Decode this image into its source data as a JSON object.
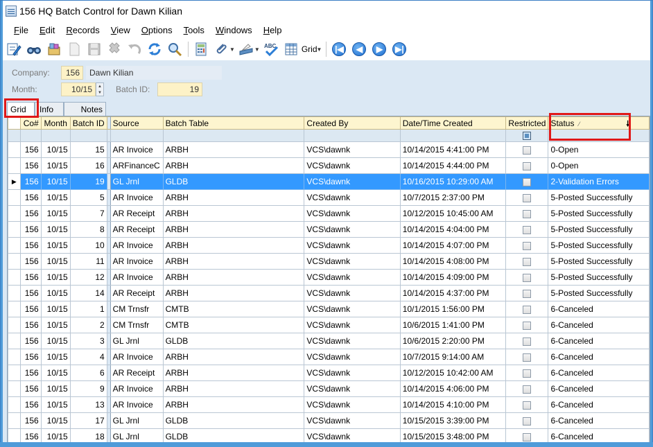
{
  "window": {
    "title": "156 HQ Batch Control for Dawn Kilian"
  },
  "menu": [
    {
      "label": "File",
      "underline": "F",
      "rest": "ile"
    },
    {
      "label": "Edit",
      "underline": "E",
      "rest": "dit"
    },
    {
      "label": "Records",
      "underline": "R",
      "rest": "ecords"
    },
    {
      "label": "View",
      "underline": "V",
      "rest": "iew"
    },
    {
      "label": "Options",
      "underline": "O",
      "rest": "ptions"
    },
    {
      "label": "Tools",
      "underline": "T",
      "rest": "ools"
    },
    {
      "label": "Windows",
      "underline": "W",
      "rest": "indows"
    },
    {
      "label": "Help",
      "underline": "H",
      "rest": "elp"
    }
  ],
  "toolbar": {
    "grid_label": "Grid"
  },
  "form": {
    "company_label": "Company:",
    "company_value": "156",
    "company_name": "Dawn Kilian",
    "month_label": "Month:",
    "month_value": "10/15",
    "batch_label": "Batch ID:",
    "batch_value": "19"
  },
  "tabs": {
    "grid": "Grid",
    "info": "Info",
    "notes": "Notes"
  },
  "grid": {
    "columns": {
      "co": "Co#",
      "month": "Month",
      "batch": "Batch ID",
      "source": "Source",
      "batch_table": "Batch Table",
      "created_by": "Created By",
      "datetime": "Date/Time Created",
      "restricted": "Restricted",
      "status": "Status"
    },
    "rows": [
      {
        "co": "156",
        "month": "10/15",
        "batch": "15",
        "source": "AR Invoice",
        "table": "ARBH",
        "by": "VCS\\dawnk",
        "dt": "10/14/2015 4:41:00 PM",
        "status": "0-Open"
      },
      {
        "co": "156",
        "month": "10/15",
        "batch": "16",
        "source": "ARFinanceC",
        "table": "ARBH",
        "by": "VCS\\dawnk",
        "dt": "10/14/2015 4:44:00 PM",
        "status": "0-Open"
      },
      {
        "co": "156",
        "month": "10/15",
        "batch": "19",
        "source": "GL Jrnl",
        "table": "GLDB",
        "by": "VCS\\dawnk",
        "dt": "10/16/2015 10:29:00 AM",
        "status": "2-Validation Errors",
        "selected": true
      },
      {
        "co": "156",
        "month": "10/15",
        "batch": "5",
        "source": "AR Invoice",
        "table": "ARBH",
        "by": "VCS\\dawnk",
        "dt": "10/7/2015 2:37:00 PM",
        "status": "5-Posted Successfully"
      },
      {
        "co": "156",
        "month": "10/15",
        "batch": "7",
        "source": "AR Receipt",
        "table": "ARBH",
        "by": "VCS\\dawnk",
        "dt": "10/12/2015 10:45:00 AM",
        "status": "5-Posted Successfully"
      },
      {
        "co": "156",
        "month": "10/15",
        "batch": "8",
        "source": "AR Receipt",
        "table": "ARBH",
        "by": "VCS\\dawnk",
        "dt": "10/14/2015 4:04:00 PM",
        "status": "5-Posted Successfully"
      },
      {
        "co": "156",
        "month": "10/15",
        "batch": "10",
        "source": "AR Invoice",
        "table": "ARBH",
        "by": "VCS\\dawnk",
        "dt": "10/14/2015 4:07:00 PM",
        "status": "5-Posted Successfully"
      },
      {
        "co": "156",
        "month": "10/15",
        "batch": "11",
        "source": "AR Invoice",
        "table": "ARBH",
        "by": "VCS\\dawnk",
        "dt": "10/14/2015 4:08:00 PM",
        "status": "5-Posted Successfully"
      },
      {
        "co": "156",
        "month": "10/15",
        "batch": "12",
        "source": "AR Invoice",
        "table": "ARBH",
        "by": "VCS\\dawnk",
        "dt": "10/14/2015 4:09:00 PM",
        "status": "5-Posted Successfully"
      },
      {
        "co": "156",
        "month": "10/15",
        "batch": "14",
        "source": "AR Receipt",
        "table": "ARBH",
        "by": "VCS\\dawnk",
        "dt": "10/14/2015 4:37:00 PM",
        "status": "5-Posted Successfully"
      },
      {
        "co": "156",
        "month": "10/15",
        "batch": "1",
        "source": "CM Trnsfr",
        "table": "CMTB",
        "by": "VCS\\dawnk",
        "dt": "10/1/2015 1:56:00 PM",
        "status": "6-Canceled"
      },
      {
        "co": "156",
        "month": "10/15",
        "batch": "2",
        "source": "CM Trnsfr",
        "table": "CMTB",
        "by": "VCS\\dawnk",
        "dt": "10/6/2015 1:41:00 PM",
        "status": "6-Canceled"
      },
      {
        "co": "156",
        "month": "10/15",
        "batch": "3",
        "source": "GL Jrnl",
        "table": "GLDB",
        "by": "VCS\\dawnk",
        "dt": "10/6/2015 2:20:00 PM",
        "status": "6-Canceled"
      },
      {
        "co": "156",
        "month": "10/15",
        "batch": "4",
        "source": "AR Invoice",
        "table": "ARBH",
        "by": "VCS\\dawnk",
        "dt": "10/7/2015 9:14:00 AM",
        "status": "6-Canceled"
      },
      {
        "co": "156",
        "month": "10/15",
        "batch": "6",
        "source": "AR Receipt",
        "table": "ARBH",
        "by": "VCS\\dawnk",
        "dt": "10/12/2015 10:42:00 AM",
        "status": "6-Canceled"
      },
      {
        "co": "156",
        "month": "10/15",
        "batch": "9",
        "source": "AR Invoice",
        "table": "ARBH",
        "by": "VCS\\dawnk",
        "dt": "10/14/2015 4:06:00 PM",
        "status": "6-Canceled"
      },
      {
        "co": "156",
        "month": "10/15",
        "batch": "13",
        "source": "AR Invoice",
        "table": "ARBH",
        "by": "VCS\\dawnk",
        "dt": "10/14/2015 4:10:00 PM",
        "status": "6-Canceled"
      },
      {
        "co": "156",
        "month": "10/15",
        "batch": "17",
        "source": "GL Jrnl",
        "table": "GLDB",
        "by": "VCS\\dawnk",
        "dt": "10/15/2015 3:39:00 PM",
        "status": "6-Canceled"
      },
      {
        "co": "156",
        "month": "10/15",
        "batch": "18",
        "source": "GL Jrnl",
        "table": "GLDB",
        "by": "VCS\\dawnk",
        "dt": "10/15/2015 3:48:00 PM",
        "status": "6-Canceled"
      }
    ]
  },
  "colors": {
    "selection": "#3399ff",
    "header_bg": "#fdf5cf",
    "highlight": "#e01818",
    "window_border": "#4f9bd9"
  }
}
